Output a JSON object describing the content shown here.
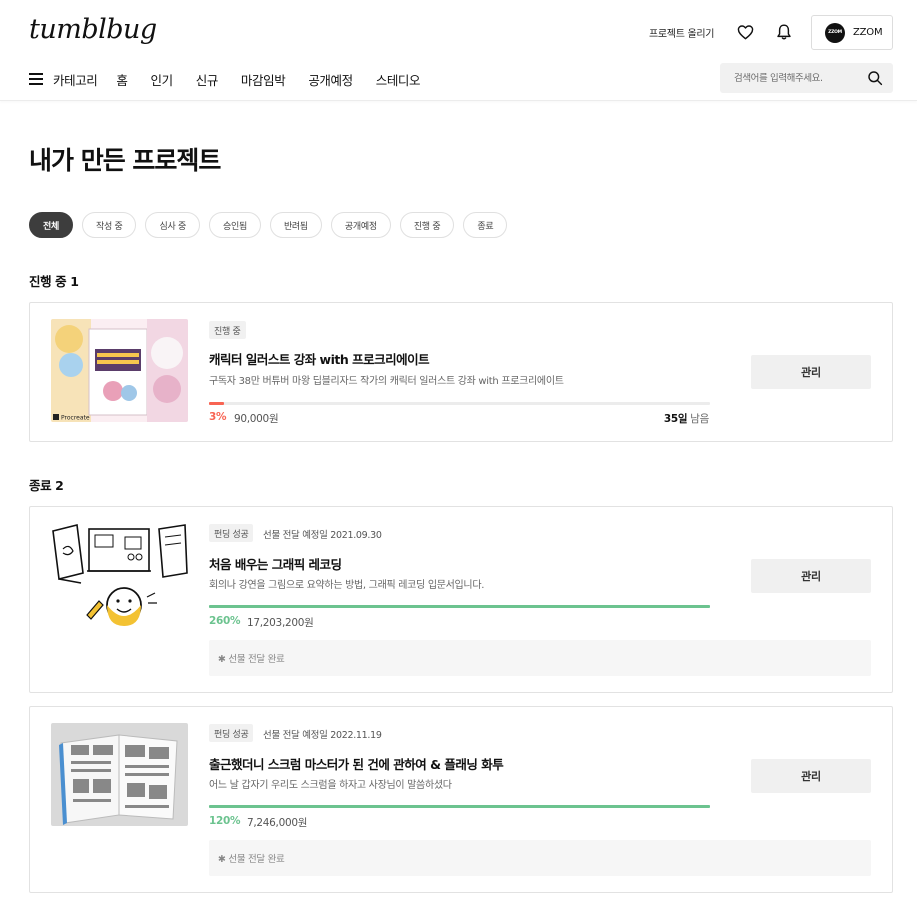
{
  "header": {
    "logo": "tumblbug",
    "upload_link": "프로젝트 올리기",
    "profile": {
      "avatar_text": "ZZOM",
      "name": "ZZOM"
    }
  },
  "nav": {
    "category": "카테고리",
    "items": [
      "홈",
      "인기",
      "신규",
      "마감임박",
      "공개예정",
      "스테디오"
    ]
  },
  "search": {
    "placeholder": "검색어를 입력해주세요."
  },
  "page_title": "내가 만든 프로젝트",
  "filters": [
    "전체",
    "작성 중",
    "심사 중",
    "승인됨",
    "반려됨",
    "공개예정",
    "진행 중",
    "종료"
  ],
  "active_filter": "전체",
  "sections": {
    "ongoing": {
      "heading": "진행 중 1",
      "project": {
        "status": "진행 중",
        "title": "캐릭터 일러스트 강좌 with 프로크리에이트",
        "description": "구독자 38만 버튜버 마왕 딥블리자드 작가의 캐릭터 일러스트 강좌 with 프로크리에이트",
        "progress_percent": 3,
        "percent_label": "3%",
        "amount": "90,000원",
        "days_left_number": "35일",
        "days_left_suffix": "남음",
        "manage_label": "관리",
        "thumb_badge": "Procreate"
      }
    },
    "ended": {
      "heading": "종료 2",
      "projects": [
        {
          "status": "펀딩 성공",
          "delivery": "선물 전달 예정일 2021.09.30",
          "title": "처음 배우는 그래픽 레코딩",
          "description": "회의나 강연을 그림으로 요약하는 방법, 그래픽 레코딩 입문서입니다.",
          "progress_percent": 100,
          "percent_label": "260%",
          "amount": "17,203,200원",
          "manage_label": "관리",
          "notice": "✱ 선물 전달 완료"
        },
        {
          "status": "펀딩 성공",
          "delivery": "선물 전달 예정일 2022.11.19",
          "title": "출근했더니 스크럼 마스터가 된 건에 관하여 & 플래닝 화투",
          "description": "어느 날 갑자기 우리도 스크럼을 하자고 사장님이 말씀하셨다",
          "progress_percent": 100,
          "percent_label": "120%",
          "amount": "7,246,000원",
          "manage_label": "관리",
          "notice": "✱ 선물 전달 완료"
        }
      ]
    }
  },
  "colors": {
    "ongoing_accent": "#f86453",
    "success_accent": "#6cc38f",
    "chip_active_bg": "#3d3d3d"
  }
}
